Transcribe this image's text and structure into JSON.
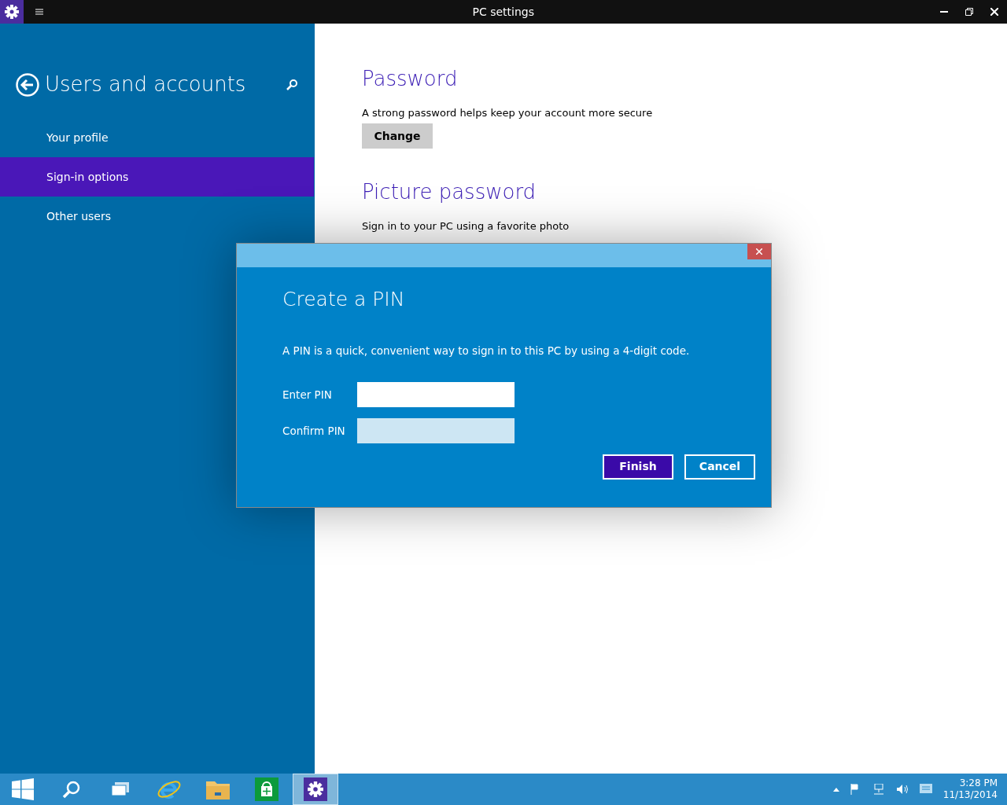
{
  "window": {
    "title": "PC settings"
  },
  "sidebar": {
    "title": "Users and accounts",
    "items": [
      {
        "label": "Your profile",
        "selected": false
      },
      {
        "label": "Sign-in options",
        "selected": true
      },
      {
        "label": "Other users",
        "selected": false
      }
    ]
  },
  "sections": [
    {
      "heading": "Password",
      "description": "A strong password helps keep your account more secure",
      "button": "Change"
    },
    {
      "heading": "Picture password",
      "description": "Sign in to your PC using a favorite photo"
    }
  ],
  "dialog": {
    "title": "Create a PIN",
    "description": "A PIN is a quick, convenient way to sign in to this PC by using a 4-digit code.",
    "fields": [
      {
        "label": "Enter PIN",
        "focused": true
      },
      {
        "label": "Confirm PIN",
        "focused": false
      }
    ],
    "buttons": [
      {
        "label": "Finish",
        "kind": "primary"
      },
      {
        "label": "Cancel",
        "kind": "secondary"
      }
    ]
  },
  "taskbar": {
    "apps": [
      {
        "kind": "start",
        "selected": false
      },
      {
        "kind": "search",
        "selected": false
      },
      {
        "kind": "taskview",
        "selected": false
      },
      {
        "kind": "browser",
        "selected": false
      },
      {
        "kind": "folder",
        "selected": false
      },
      {
        "kind": "store",
        "selected": false
      },
      {
        "kind": "settings",
        "selected": true
      }
    ],
    "clock": {
      "time": "3:28 PM",
      "date": "11/13/2014"
    }
  }
}
